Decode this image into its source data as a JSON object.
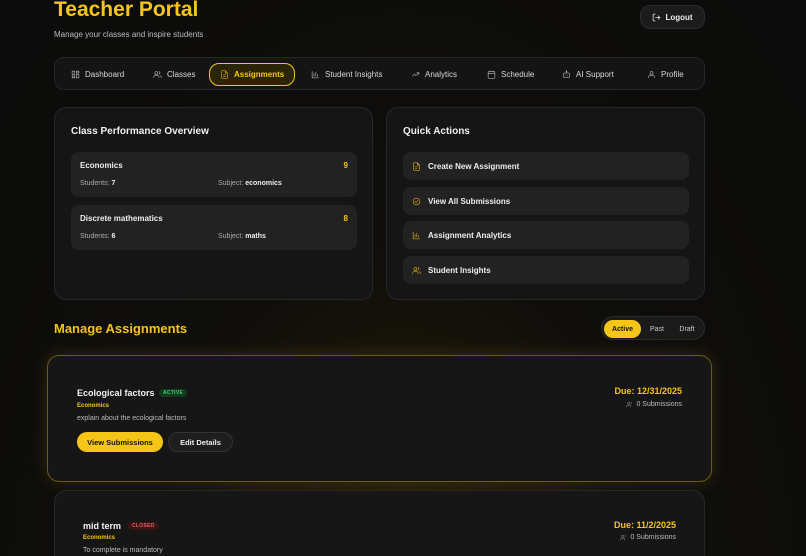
{
  "header": {
    "title": "Teacher Portal",
    "subtitle": "Manage your classes and inspire students",
    "logout_label": "Logout"
  },
  "nav": {
    "tabs": [
      {
        "label": "Dashboard",
        "icon": "dashboard-icon"
      },
      {
        "label": "Classes",
        "icon": "users-icon"
      },
      {
        "label": "Assignments",
        "icon": "file-icon",
        "active": true
      },
      {
        "label": "Student Insights",
        "icon": "bar-chart-icon"
      },
      {
        "label": "Analytics",
        "icon": "trending-icon"
      },
      {
        "label": "Schedule",
        "icon": "calendar-icon"
      },
      {
        "label": "AI Support",
        "icon": "bot-icon"
      },
      {
        "label": "Profile",
        "icon": "user-icon"
      }
    ]
  },
  "performance": {
    "title": "Class Performance Overview",
    "students_label": "Students:",
    "subject_label": "Subject:",
    "classes": [
      {
        "name": "Economics",
        "count": "9",
        "students": "7",
        "subject": "economics"
      },
      {
        "name": "Discrete mathematics",
        "count": "8",
        "students": "6",
        "subject": "maths"
      }
    ]
  },
  "quick_actions": {
    "title": "Quick Actions",
    "items": [
      {
        "label": "Create New Assignment",
        "icon": "file-plus-icon"
      },
      {
        "label": "View All Submissions",
        "icon": "check-circle-icon"
      },
      {
        "label": "Assignment Analytics",
        "icon": "bar-chart-icon"
      },
      {
        "label": "Student Insights",
        "icon": "users-icon"
      }
    ]
  },
  "manage": {
    "title": "Manage Assignments",
    "filters": [
      "Active",
      "Past",
      "Draft"
    ],
    "active_filter": "Active",
    "assignments": [
      {
        "title": "Ecological factors",
        "status": "ACTIVE",
        "subject": "Economics",
        "description": "explain about the ecological factors",
        "due": "Due: 12/31/2025",
        "submissions": "0 Submissions",
        "view_label": "View Submissions",
        "edit_label": "Edit Details"
      },
      {
        "title": "mid term",
        "status": "CLOSED",
        "subject": "Economics",
        "description": "To complete is mandatory",
        "due": "Due: 11/2/2025",
        "submissions": "0 Submissions"
      }
    ]
  },
  "colors": {
    "accent": "#f5c518",
    "background": "#0b0b0b",
    "card": "#151515",
    "active_badge": "#3ecf6a",
    "closed_badge": "#e06060"
  }
}
